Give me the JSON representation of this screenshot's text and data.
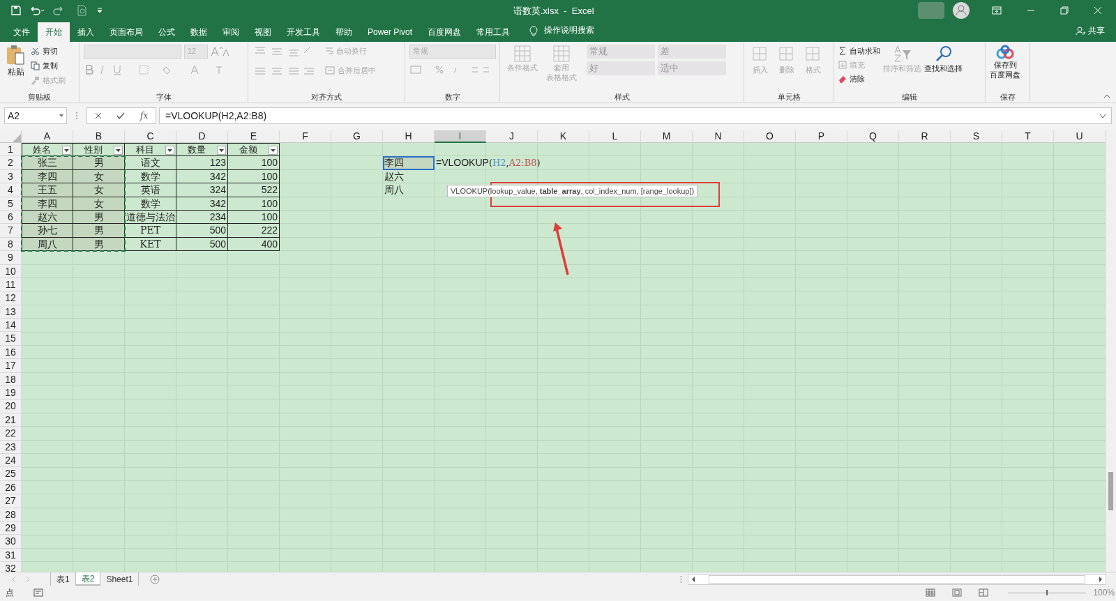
{
  "window": {
    "title": "语数英.xlsx  -  Excel"
  },
  "menu_tabs": [
    {
      "label": "文件",
      "selected": false
    },
    {
      "label": "开始",
      "selected": true
    },
    {
      "label": "插入",
      "selected": false
    },
    {
      "label": "页面布局",
      "selected": false
    },
    {
      "label": "公式",
      "selected": false
    },
    {
      "label": "数据",
      "selected": false
    },
    {
      "label": "审阅",
      "selected": false
    },
    {
      "label": "视图",
      "selected": false
    },
    {
      "label": "开发工具",
      "selected": false
    },
    {
      "label": "帮助",
      "selected": false
    },
    {
      "label": "Power Pivot",
      "selected": false
    },
    {
      "label": "百度网盘",
      "selected": false
    },
    {
      "label": "常用工具",
      "selected": false
    }
  ],
  "search_hint": "操作说明搜索",
  "share": "共享",
  "ribbon": {
    "clipboard": {
      "label": "剪贴板",
      "paste": "粘贴",
      "cut": "剪切",
      "copy": "复制",
      "format_painter": "格式刷"
    },
    "font": {
      "label": "字体",
      "size": "12"
    },
    "alignment": {
      "label": "对齐方式",
      "wrap": "自动换行",
      "merge": "合并后居中"
    },
    "number": {
      "label": "数字",
      "format": "常规"
    },
    "styles": {
      "label": "样式",
      "conditional": "条件格式",
      "table_format": [
        "套用",
        "表格格式"
      ],
      "gallery": [
        "常规",
        "差",
        "好",
        "适中"
      ]
    },
    "cells": {
      "label": "单元格",
      "buttons": [
        "插入",
        "删除",
        "格式"
      ]
    },
    "editing": {
      "label": "编辑",
      "autosum": "自动求和",
      "fill": "填充",
      "clear": "清除",
      "sort": "排序和筛选",
      "find": "查找和选择"
    },
    "save": {
      "label": "保存",
      "button": [
        "保存到",
        "百度网盘"
      ]
    }
  },
  "formula_bar": {
    "name_box": "A2",
    "fx": "fx",
    "formula": "=VLOOKUP(H2,A2:B8)"
  },
  "columns": [
    {
      "label": "A",
      "selected": false
    },
    {
      "label": "B",
      "selected": false
    },
    {
      "label": "C",
      "selected": false
    },
    {
      "label": "D",
      "selected": false
    },
    {
      "label": "E",
      "selected": false
    },
    {
      "label": "F",
      "selected": false
    },
    {
      "label": "G",
      "selected": false
    },
    {
      "label": "H",
      "selected": false
    },
    {
      "label": "I",
      "selected": true
    },
    {
      "label": "J",
      "selected": false
    },
    {
      "label": "K",
      "selected": false
    },
    {
      "label": "L",
      "selected": false
    },
    {
      "label": "M",
      "selected": false
    },
    {
      "label": "N",
      "selected": false
    },
    {
      "label": "O",
      "selected": false
    },
    {
      "label": "P",
      "selected": false
    },
    {
      "label": "Q",
      "selected": false
    },
    {
      "label": "R",
      "selected": false
    },
    {
      "label": "S",
      "selected": false
    },
    {
      "label": "T",
      "selected": false
    },
    {
      "label": "U",
      "selected": false
    }
  ],
  "rows": [
    {
      "number": "1",
      "cells": [
        {
          "kind": "text",
          "text": "姓名",
          "boxed": true,
          "filter": true
        },
        {
          "kind": "text",
          "text": "性别",
          "boxed": true,
          "filter": true
        },
        {
          "kind": "text",
          "text": "科目",
          "boxed": true,
          "filter": true
        },
        {
          "kind": "text",
          "text": "数量",
          "boxed": true,
          "filter": true
        },
        {
          "kind": "text",
          "text": "金额",
          "boxed": true,
          "filter": true
        }
      ]
    },
    {
      "number": "2",
      "cells": [
        {
          "kind": "text",
          "text": "张三",
          "boxed": true,
          "in_copy_range": true
        },
        {
          "kind": "text",
          "text": "男",
          "boxed": true,
          "in_copy_range": true
        },
        {
          "kind": "text",
          "text": "语文",
          "boxed": true
        },
        {
          "kind": "number",
          "text": "123",
          "boxed": true
        },
        {
          "kind": "number",
          "text": "100",
          "boxed": true
        },
        null,
        null,
        {
          "kind": "left",
          "text": "李四",
          "active": true
        },
        {
          "kind": "formula",
          "parts": [
            {
              "text": "=VLOOKUP"
            },
            {
              "text": "("
            },
            {
              "text": "H2",
              "color": "#4f8fd6"
            },
            {
              "text": ","
            },
            {
              "text": "A2:B8",
              "color": "#c0504d"
            },
            {
              "text": ")"
            }
          ]
        }
      ]
    },
    {
      "number": "3",
      "cells": [
        {
          "kind": "text",
          "text": "李四",
          "boxed": true,
          "in_copy_range": true
        },
        {
          "kind": "text",
          "text": "女",
          "boxed": true,
          "in_copy_range": true
        },
        {
          "kind": "text",
          "text": "数学",
          "boxed": true
        },
        {
          "kind": "number",
          "text": "342",
          "boxed": true
        },
        {
          "kind": "number",
          "text": "100",
          "boxed": true
        },
        null,
        null,
        {
          "kind": "left",
          "text": "赵六"
        }
      ]
    },
    {
      "number": "4",
      "cells": [
        {
          "kind": "text",
          "text": "王五",
          "boxed": true,
          "in_copy_range": true
        },
        {
          "kind": "text",
          "text": "女",
          "boxed": true,
          "in_copy_range": true
        },
        {
          "kind": "text",
          "text": "英语",
          "boxed": true
        },
        {
          "kind": "number",
          "text": "324",
          "boxed": true
        },
        {
          "kind": "number",
          "text": "522",
          "boxed": true
        },
        null,
        null,
        {
          "kind": "left",
          "text": "周八"
        }
      ]
    },
    {
      "number": "5",
      "cells": [
        {
          "kind": "text",
          "text": "李四",
          "boxed": true,
          "in_copy_range": true
        },
        {
          "kind": "text",
          "text": "女",
          "boxed": true,
          "in_copy_range": true
        },
        {
          "kind": "text",
          "text": "数学",
          "boxed": true
        },
        {
          "kind": "number",
          "text": "342",
          "boxed": true
        },
        {
          "kind": "number",
          "text": "100",
          "boxed": true
        }
      ]
    },
    {
      "number": "6",
      "cells": [
        {
          "kind": "text",
          "text": "赵六",
          "boxed": true,
          "in_copy_range": true
        },
        {
          "kind": "text",
          "text": "男",
          "boxed": true,
          "in_copy_range": true
        },
        {
          "kind": "text",
          "text": "道德与法治",
          "boxed": true
        },
        {
          "kind": "number",
          "text": "234",
          "boxed": true
        },
        {
          "kind": "number",
          "text": "100",
          "boxed": true
        }
      ]
    },
    {
      "number": "7",
      "cells": [
        {
          "kind": "text",
          "text": "孙七",
          "boxed": true,
          "in_copy_range": true
        },
        {
          "kind": "text",
          "text": "男",
          "boxed": true,
          "in_copy_range": true
        },
        {
          "kind": "text",
          "text": "PET",
          "boxed": true
        },
        {
          "kind": "number",
          "text": "500",
          "boxed": true
        },
        {
          "kind": "number",
          "text": "222",
          "boxed": true
        }
      ]
    },
    {
      "number": "8",
      "cells": [
        {
          "kind": "text",
          "text": "周八",
          "boxed": true,
          "in_copy_range": true
        },
        {
          "kind": "text",
          "text": "男",
          "boxed": true,
          "in_copy_range": true
        },
        {
          "kind": "text",
          "text": "KET",
          "boxed": true
        },
        {
          "kind": "number",
          "text": "500",
          "boxed": true
        },
        {
          "kind": "number",
          "text": "400",
          "boxed": true
        }
      ]
    },
    {
      "number": "9"
    },
    {
      "number": "10"
    },
    {
      "number": "11"
    },
    {
      "number": "12"
    },
    {
      "number": "13"
    },
    {
      "number": "14"
    },
    {
      "number": "15"
    },
    {
      "number": "16"
    },
    {
      "number": "17"
    },
    {
      "number": "18"
    },
    {
      "number": "19"
    },
    {
      "number": "20"
    },
    {
      "number": "21"
    },
    {
      "number": "22"
    },
    {
      "number": "23"
    },
    {
      "number": "24"
    },
    {
      "number": "25"
    },
    {
      "number": "26"
    },
    {
      "number": "27"
    },
    {
      "number": "28"
    },
    {
      "number": "29"
    },
    {
      "number": "30"
    },
    {
      "number": "31"
    },
    {
      "number": "32"
    }
  ],
  "tooltip": "VLOOKUP(lookup_value, **table_array**, col_index_num, [range_lookup])",
  "sheet_tabs": [
    {
      "label": "表1",
      "selected": false
    },
    {
      "label": "表2",
      "selected": true
    },
    {
      "label": "Sheet1",
      "selected": false
    }
  ],
  "status_bar": {
    "mode": "点",
    "zoom_slider": {
      "level": 0.5
    },
    "zoom": "100%"
  }
}
